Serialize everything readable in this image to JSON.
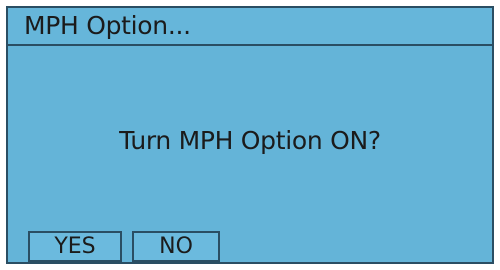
{
  "dialog": {
    "title": "MPH Option...",
    "message": "Turn MPH Option ON?"
  },
  "buttons": {
    "yes_label": "YES",
    "no_label": "NO"
  },
  "colors": {
    "background": "#64b4d8",
    "border": "#2a4e63",
    "text": "#1b1b1b"
  }
}
